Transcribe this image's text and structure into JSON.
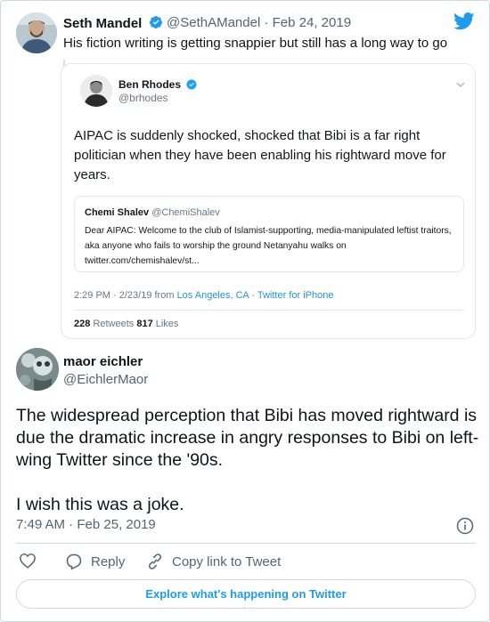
{
  "quoted_by": {
    "name": "Seth Mandel",
    "handle": "@SethAMandel",
    "date": "· Feb 24, 2019",
    "text": "His fiction writing is getting snappier but still has a long way to go"
  },
  "embedded_tweet": {
    "name": "Ben Rhodes",
    "handle": "@brhodes",
    "text": "AIPAC is suddenly shocked, shocked that Bibi is a far right politician when they have been enabling his rightward move for years.",
    "quoted": {
      "name": "Chemi Shalev",
      "handle": "@ChemiShalev",
      "text": "Dear AIPAC: Welcome to the club of Islamist-supporting, media-manipulated leftist traitors, aka anyone who fails to worship the ground Netanyahu walks on twitter.com/chemishalev/st..."
    },
    "time": "2:29 PM · 2/23/19 from ",
    "location": "Los Angeles, CA",
    "source_sep": " · ",
    "source": "Twitter for iPhone",
    "retweets": "228",
    "retweets_label": " Retweets ",
    "likes": "817",
    "likes_label": " Likes"
  },
  "main_tweet": {
    "name": "maor eichler",
    "handle": "@EichlerMaor",
    "text_1": "The widespread perception that Bibi has moved rightward is due the dramatic increase in angry responses to Bibi on left-wing Twitter since the '90s.",
    "text_2": "I wish this was a joke.",
    "timestamp": "7:49 AM · Feb 25, 2019"
  },
  "actions": {
    "reply": "Reply",
    "copy_link": "Copy link to Tweet"
  },
  "explore_button": "Explore what's happening on Twitter",
  "colors": {
    "brand_blue": "#1d9bf0",
    "text_secondary": "#536471",
    "border": "#cfd9de"
  },
  "icons": [
    "twitter-bird-icon",
    "verified-badge-icon",
    "chevron-down-icon",
    "info-icon",
    "heart-icon",
    "reply-icon",
    "link-icon"
  ]
}
